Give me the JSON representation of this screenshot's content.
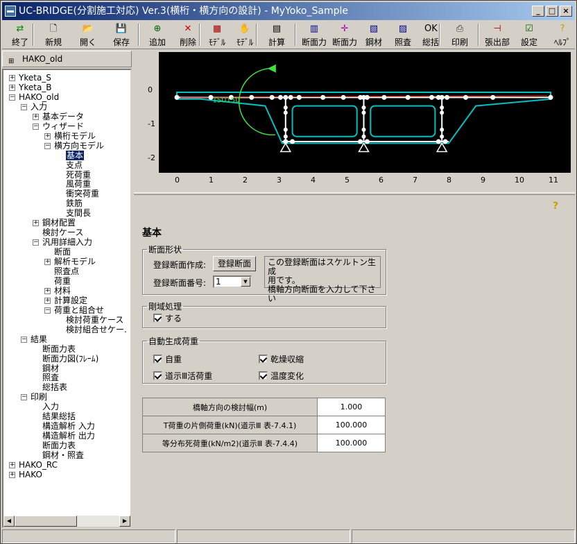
{
  "window": {
    "title": "UC-BRIDGE(分割施工対応) Ver.3(横桁・横方向の設計) - MyYoko_Sample",
    "minimize": "_",
    "maximize": "□",
    "close": "×"
  },
  "toolbar": [
    {
      "label": "終了",
      "icon": "exit-icon"
    },
    {
      "label": "新規",
      "icon": "new-file-icon"
    },
    {
      "label": "開く",
      "icon": "open-folder-icon"
    },
    {
      "label": "保存",
      "icon": "save-icon"
    },
    {
      "label": "追加",
      "icon": "add-icon"
    },
    {
      "label": "削除",
      "icon": "delete-icon"
    },
    {
      "label": "ﾓﾃﾞﾙ",
      "icon": "model-icon"
    },
    {
      "label": "ﾓﾃﾞﾙ",
      "icon": "model-hand-icon"
    },
    {
      "label": "計算",
      "icon": "calculator-icon"
    },
    {
      "label": "断面力",
      "icon": "section-force-icon"
    },
    {
      "label": "断面力",
      "icon": "section-force-diagram-icon"
    },
    {
      "label": "鋼材",
      "icon": "steel-icon"
    },
    {
      "label": "照査",
      "icon": "verify-icon"
    },
    {
      "label": "総括",
      "icon": "ok-summary-icon"
    },
    {
      "label": "印刷",
      "icon": "print-icon"
    },
    {
      "label": "張出部",
      "icon": "cantilever-icon"
    },
    {
      "label": "設定",
      "icon": "settings-icon"
    },
    {
      "label": "ﾍﾙﾌﾟ",
      "icon": "help-icon"
    }
  ],
  "tree": {
    "header": "HAKO_old",
    "items": [
      {
        "label": "Yketa_S",
        "exp": "+"
      },
      {
        "label": "Yketa_B",
        "exp": "+"
      },
      {
        "label": "HAKO_old",
        "exp": "-"
      },
      {
        "label": "入力",
        "exp": "-"
      },
      {
        "label": "基本データ",
        "exp": "+"
      },
      {
        "label": "ウィザード",
        "exp": "-"
      },
      {
        "label": "横桁モデル",
        "exp": "+"
      },
      {
        "label": "横方向モデル",
        "exp": "-"
      },
      {
        "label": "基本",
        "exp": ""
      },
      {
        "label": "支点",
        "exp": ""
      },
      {
        "label": "死荷重",
        "exp": ""
      },
      {
        "label": "風荷重",
        "exp": ""
      },
      {
        "label": "衝突荷重",
        "exp": ""
      },
      {
        "label": "鉄筋",
        "exp": ""
      },
      {
        "label": "支間長",
        "exp": ""
      },
      {
        "label": "鋼材配置",
        "exp": "+"
      },
      {
        "label": "検討ケース",
        "exp": ""
      },
      {
        "label": "汎用詳細入力",
        "exp": "-"
      },
      {
        "label": "断面",
        "exp": ""
      },
      {
        "label": "解析モデル",
        "exp": "+"
      },
      {
        "label": "照査点",
        "exp": ""
      },
      {
        "label": "荷重",
        "exp": ""
      },
      {
        "label": "材料",
        "exp": "+"
      },
      {
        "label": "計算設定",
        "exp": "+"
      },
      {
        "label": "荷重と組合せ",
        "exp": "-"
      },
      {
        "label": "検討荷重ケース",
        "exp": ""
      },
      {
        "label": "検討組合せケー.",
        "exp": ""
      },
      {
        "label": "結果",
        "exp": "-"
      },
      {
        "label": "断面力表",
        "exp": ""
      },
      {
        "label": "断面力図(ﾌﾚｰﾑ)",
        "exp": ""
      },
      {
        "label": "鋼材",
        "exp": ""
      },
      {
        "label": "照査",
        "exp": ""
      },
      {
        "label": "総括表",
        "exp": ""
      },
      {
        "label": "印刷",
        "exp": "-"
      },
      {
        "label": "入力",
        "exp": ""
      },
      {
        "label": "結果総括",
        "exp": ""
      },
      {
        "label": "構造解析 入力",
        "exp": ""
      },
      {
        "label": "構造解析 出力",
        "exp": ""
      },
      {
        "label": "断面力表",
        "exp": ""
      },
      {
        "label": "鋼材・照査",
        "exp": ""
      },
      {
        "label": "HAKO_RC",
        "exp": "+"
      },
      {
        "label": "HAKO",
        "exp": "+"
      }
    ]
  },
  "plot": {
    "y_ticks": [
      "0",
      "-1",
      "-2"
    ],
    "x_ticks": [
      "0",
      "1",
      "2",
      "3",
      "4",
      "5",
      "6",
      "7",
      "8",
      "9",
      "10",
      "11"
    ],
    "annotation": "15U150",
    "colors": {
      "bg": "#000000",
      "section": "#00c0c0",
      "frame": "#ffffff",
      "arrow": "#40e040",
      "load": "#ff2020"
    }
  },
  "form": {
    "title": "基本",
    "section_shape": {
      "legend": "断面形状",
      "reg_label": "登録断面作成:",
      "reg_button": "登録断面",
      "num_label": "登録断面番号:",
      "num_value": "1",
      "note": [
        "この登録断面はスケルトン生成",
        "用です。",
        "橋軸方向断面を入力して下さい"
      ]
    },
    "rigid": {
      "legend": "剛域処理",
      "option": "する",
      "checked": true
    },
    "auto_load": {
      "legend": "自動生成荷重",
      "options": [
        {
          "label": "自重",
          "checked": true
        },
        {
          "label": "乾燥収縮",
          "checked": true
        },
        {
          "label": "道示Ⅲ活荷重",
          "checked": true
        },
        {
          "label": "温度変化",
          "checked": true
        }
      ]
    },
    "table": [
      {
        "label": "橋軸方向の検討幅(m)",
        "value": "1.000"
      },
      {
        "label": "T荷重の片側荷重(kN)(道示Ⅲ 表-7.4.1)",
        "value": "100.000"
      },
      {
        "label": "等分布死荷重(kN/m2)(道示Ⅲ 表-7.4.4)",
        "value": "100.000"
      }
    ]
  }
}
